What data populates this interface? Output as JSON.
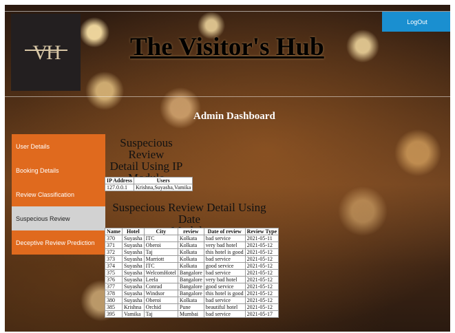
{
  "header": {
    "logo_text": "VH",
    "site_title": "The Visitor's Hub",
    "logout_label": "LogOut"
  },
  "dashboard_title": "Admin Dashboard",
  "sidebar": {
    "items": [
      {
        "label": "User Details",
        "active": false
      },
      {
        "label": "Booking Details",
        "active": false
      },
      {
        "label": "Review Classification",
        "active": false
      },
      {
        "label": "Suspecious Review",
        "active": true
      },
      {
        "label": "Deceptive Review Prediction",
        "active": false
      }
    ]
  },
  "ip_section": {
    "title_line1": "Suspecious Review",
    "title_line2": "Detail Using IP",
    "title_line3": "Module",
    "columns": [
      "IP Address",
      "Users"
    ],
    "rows": [
      [
        "127.0.0.1",
        "Krishna,Suyasha,Vamika"
      ]
    ]
  },
  "date_section": {
    "title_line1": "Suspecious Review Detail Using Date",
    "title_line2": "Module",
    "columns": [
      "Name",
      "Hotel",
      "City",
      "review",
      "Date of review",
      "Review Type"
    ],
    "rows": [
      [
        "370",
        "Suyasha",
        "ITC",
        "Kolkata",
        "bad service",
        "2021-05-11"
      ],
      [
        "371",
        "Suyasha",
        "Oberoi",
        "Kolkata",
        "very bad hotel",
        "2021-05-12"
      ],
      [
        "372",
        "Suyasha",
        "Taj",
        "Kolkata",
        "this hotel is good",
        "2021-05-12"
      ],
      [
        "373",
        "Suyasha",
        "Marriott",
        "Kolkata",
        "bad service",
        "2021-05-12"
      ],
      [
        "374",
        "Suyasha",
        "ITC",
        "Kolkata",
        "good service",
        "2021-05-12"
      ],
      [
        "375",
        "Suyasha",
        "WelcomHotel",
        "Bangalore",
        "bad service",
        "2021-05-12"
      ],
      [
        "376",
        "Suyasha",
        "Leela",
        "Bangalore",
        "very bad hotel",
        "2021-05-12"
      ],
      [
        "377",
        "Suyasha",
        "Conrad",
        "Bangalore",
        "good service",
        "2021-05-12"
      ],
      [
        "378",
        "Suyasha",
        "Windsor",
        "Bangalore",
        "this hotel is good",
        "2021-05-12"
      ],
      [
        "380",
        "Suyasha",
        "Oberoi",
        "Kolkata",
        "bad service",
        "2021-05-12"
      ],
      [
        "385",
        "Krishna",
        "Orchid",
        "Pune",
        "beautiful hotel",
        "2021-05-12"
      ],
      [
        "395",
        "Vamika",
        "Taj",
        "Mumbai",
        "bad service",
        "2021-05-17"
      ]
    ]
  },
  "colors": {
    "accent_orange": "#e06a1e",
    "logout_blue": "#1a8fd0",
    "active_item": "#d2d2d2"
  }
}
